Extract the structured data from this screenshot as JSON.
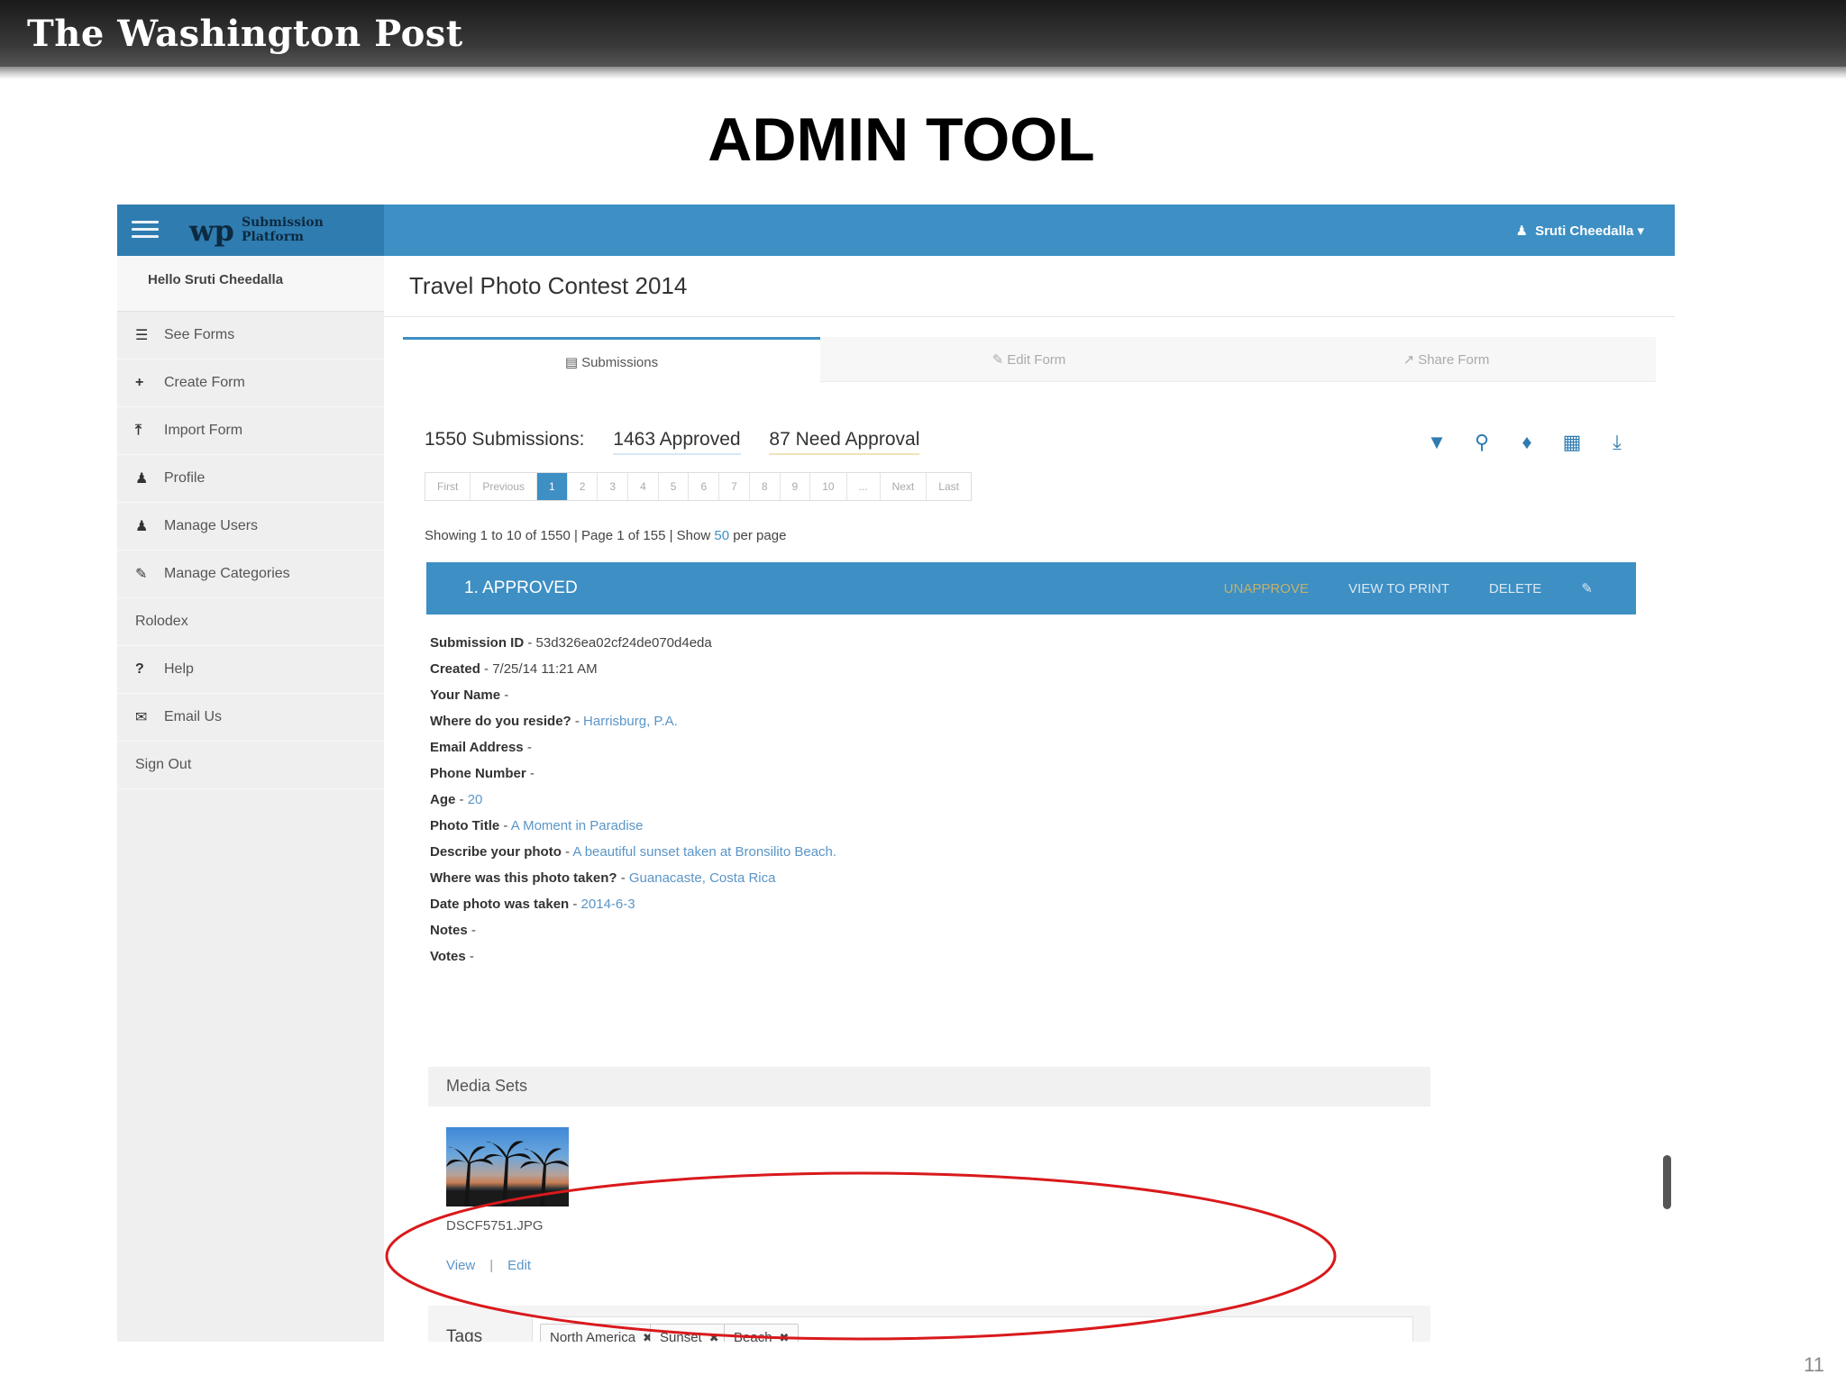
{
  "slide": {
    "logo": "The Washington Post",
    "title": "ADMIN TOOL",
    "page_number": "11"
  },
  "app": {
    "brand_logo": "wp",
    "brand_name": "Submission Platform",
    "user_menu": "Sruti Cheedalla ▾",
    "greeting": "Hello Sruti Cheedalla",
    "nav": [
      {
        "label": "See Forms",
        "icon": "list-icon"
      },
      {
        "label": "Create Form",
        "icon": "plus-icon"
      },
      {
        "label": "Import Form",
        "icon": "upload-icon"
      },
      {
        "label": "Profile",
        "icon": "user-icon"
      },
      {
        "label": "Manage Users",
        "icon": "users-icon"
      },
      {
        "label": "Manage Categories",
        "icon": "pencil-icon"
      },
      {
        "label": "Rolodex",
        "icon": ""
      },
      {
        "label": "Help",
        "icon": "question-icon"
      },
      {
        "label": "Email Us",
        "icon": "envelope-icon"
      },
      {
        "label": "Sign Out",
        "icon": ""
      }
    ],
    "page_title": "Travel Photo Contest 2014",
    "tabs": [
      {
        "label": "Submissions",
        "icon": "table-icon"
      },
      {
        "label": "Edit Form",
        "icon": "edit-icon"
      },
      {
        "label": "Share Form",
        "icon": "share-icon"
      }
    ],
    "counts": {
      "total": "1550 Submissions:",
      "approved": "1463 Approved",
      "need_approval": "87 Need Approval"
    },
    "tools": [
      "filter-icon",
      "search-icon",
      "tags-icon",
      "calendar-icon",
      "download-icon"
    ],
    "pager": [
      "First",
      "Previous",
      "1",
      "2",
      "3",
      "4",
      "5",
      "6",
      "7",
      "8",
      "9",
      "10",
      "...",
      "Next",
      "Last"
    ],
    "pager_active_index": 2,
    "showing": {
      "prefix": "Showing 1 to 10 of 1550 | Page 1 of 155 | Show ",
      "link": "50",
      "suffix": " per page"
    },
    "submission": {
      "title": "1. APPROVED",
      "actions": {
        "unapprove": "UNAPPROVE",
        "print": "VIEW TO PRINT",
        "delete": "DELETE"
      },
      "fields": [
        {
          "k": "Submission ID",
          "v": "53d326ea02cf24de070d4eda",
          "plain": true
        },
        {
          "k": "Created",
          "v": "7/25/14 11:21 AM",
          "plain": true
        },
        {
          "k": "Your Name",
          "v": ""
        },
        {
          "k": "Where do you reside?",
          "v": "Harrisburg, P.A."
        },
        {
          "k": "Email Address",
          "v": ""
        },
        {
          "k": "Phone Number",
          "v": ""
        },
        {
          "k": "Age",
          "v": "20"
        },
        {
          "k": "Photo Title",
          "v": "A Moment in Paradise"
        },
        {
          "k": "Describe your photo",
          "v": "A beautiful sunset taken at Bronsilito Beach."
        },
        {
          "k": "Where was this photo taken?",
          "v": "Guanacaste, Costa Rica"
        },
        {
          "k": "Date photo was taken",
          "v": "2014-6-3"
        },
        {
          "k": "Notes",
          "v": ""
        },
        {
          "k": "Votes",
          "v": ""
        }
      ],
      "media_sets_label": "Media Sets",
      "media_filename": "DSCF5751.JPG",
      "view_label": "View",
      "edit_label": "Edit",
      "tags_label": "Tags",
      "tags": [
        "North America",
        "Sunset",
        "Beach"
      ]
    }
  },
  "colors": {
    "accent": "#3d8fc4",
    "highlight_ellipse": "#d9191c"
  }
}
